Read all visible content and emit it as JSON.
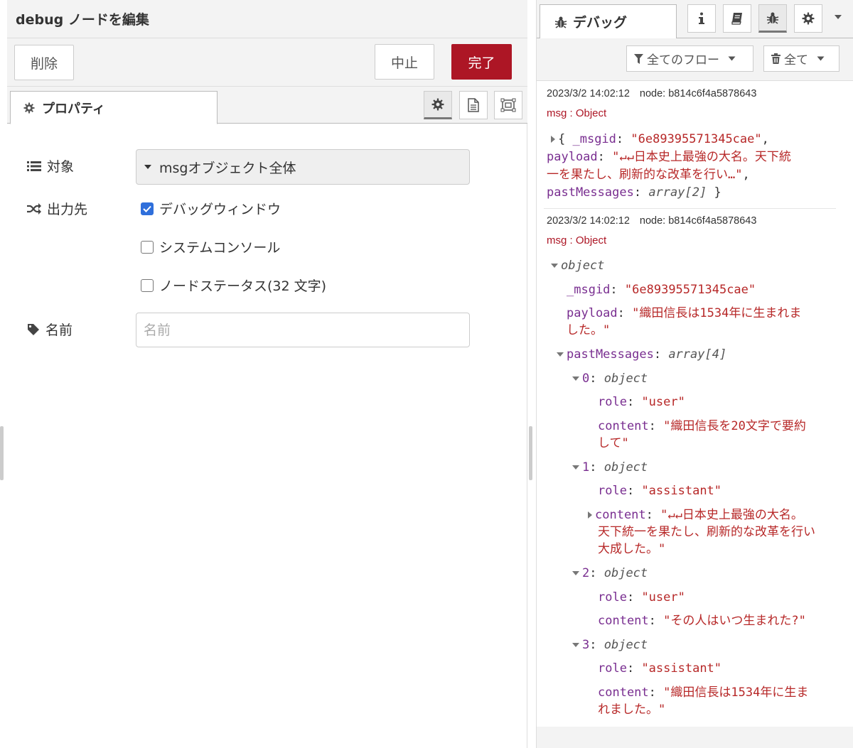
{
  "editor": {
    "title": "debug ノードを編集",
    "delete_label": "削除",
    "cancel_label": "中止",
    "done_label": "完了",
    "tab_properties": "プロパティ",
    "fields": {
      "target_label": "対象",
      "target_value": "msgオブジェクト全体",
      "output_label": "出力先",
      "opt_debug_window": "デバッグウィンドウ",
      "opt_debug_window_checked": true,
      "opt_system_console": "システムコンソール",
      "opt_system_console_checked": false,
      "opt_node_status": "ノードステータス(32 文字)",
      "opt_node_status_checked": false,
      "name_label": "名前",
      "name_placeholder": "名前",
      "name_value": ""
    },
    "colors": {
      "done": "#ad1625"
    }
  },
  "sidebar": {
    "tab_label": "デバッグ",
    "filter_label": "全てのフロー",
    "clear_label": "全て",
    "messages": [
      {
        "timestamp": "2023/3/2 14:02:12",
        "node": "node: b814c6f4a5878643",
        "type": "msg : Object",
        "collapsed": {
          "open": "{ ",
          "msgid_key": "_msgid",
          "msgid_val": "\"6e89395571345cae\"",
          "payload_key": "payload",
          "payload_val_1": "\"↵↵日本史上最強の大名。天下統",
          "payload_val_2": "一を果たし、刷新的な改革を行い…\"",
          "past_key": "pastMessages",
          "past_val": "array[2]",
          "close": " }"
        }
      },
      {
        "timestamp": "2023/3/2 14:02:12",
        "node": "node: b814c6f4a5878643",
        "type": "msg : Object",
        "tree": {
          "root": "object",
          "msgid_key": "_msgid",
          "msgid_val": "\"6e89395571345cae\"",
          "payload_key": "payload",
          "payload_val_1": "\"織田信長は1534年に生まれま",
          "payload_val_2": "した。\"",
          "past_key": "pastMessages",
          "past_val": "array[4]",
          "items": [
            {
              "index": "0",
              "type": "object",
              "role_key": "role",
              "role": "\"user\"",
              "content_key": "content",
              "content_1": "\"織田信長を20文字で要約",
              "content_2": "して\""
            },
            {
              "index": "1",
              "type": "object",
              "role_key": "role",
              "role": "\"assistant\"",
              "content_key": "content",
              "content_1": "\"↵↵日本史上最強の大名。",
              "content_2": "天下統一を果たし、刷新的な改革を行い",
              "content_3": "大成した。\""
            },
            {
              "index": "2",
              "type": "object",
              "role_key": "role",
              "role": "\"user\"",
              "content_key": "content",
              "content_1": "\"その人はいつ生まれた?\""
            },
            {
              "index": "3",
              "type": "object",
              "role_key": "role",
              "role": "\"assistant\"",
              "content_key": "content",
              "content_1": "\"織田信長は1534年に生ま",
              "content_2": "れました。\""
            }
          ]
        }
      }
    ]
  }
}
